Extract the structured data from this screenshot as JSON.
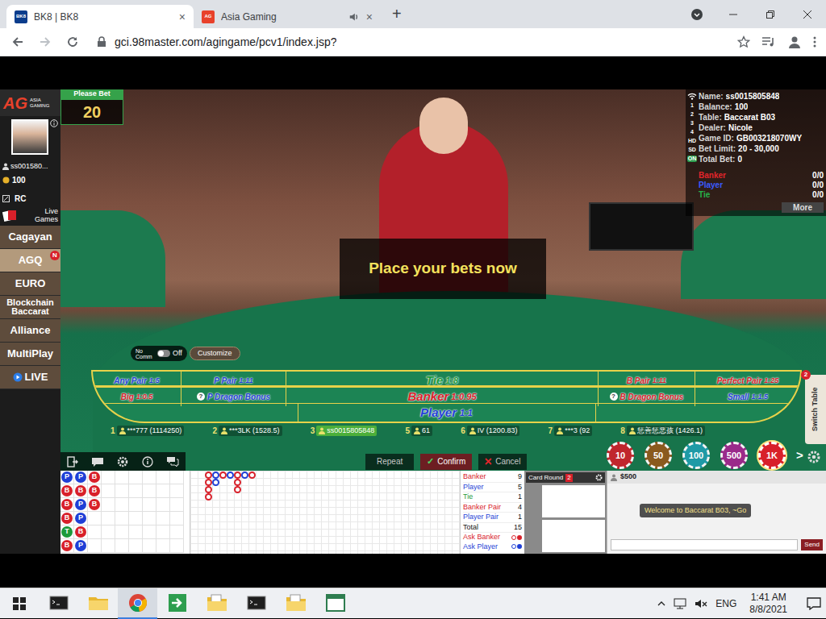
{
  "browser": {
    "tabs": [
      {
        "label": "BK8 | BK8",
        "favicon": "BK8",
        "close": "×",
        "audio": false,
        "selected": true
      },
      {
        "label": "Asia Gaming",
        "favicon": "AG",
        "close": "×",
        "audio": true,
        "selected": false
      }
    ],
    "new_tab": "+",
    "url": "gci.98master.com/agingame/pcv1/index.jsp?"
  },
  "sidebar": {
    "logo": "AG",
    "logo_sub": "ASIA GAMING",
    "user": "ss001580...",
    "balance": "100",
    "rc": "RC",
    "live_games": "Live Games",
    "items": [
      {
        "label": "Cagayan",
        "selected": false
      },
      {
        "label": "AGQ",
        "selected": true,
        "badge": "N"
      },
      {
        "label": "EURO",
        "selected": false
      },
      {
        "label": "Blockchain Baccarat",
        "selected": false
      },
      {
        "label": "Alliance",
        "selected": false
      },
      {
        "label": "MultiPlay",
        "selected": false
      },
      {
        "label": "LIVE",
        "selected": false
      }
    ]
  },
  "game": {
    "please_bet": "Please Bet",
    "countdown": "20",
    "message": "Place your bets now",
    "no_comm": {
      "label": "No Comm",
      "state": "Off",
      "on": false
    },
    "customize": "Customize",
    "info": {
      "side": [
        "1",
        "2",
        "3",
        "4",
        "HD",
        "SD",
        "ON"
      ],
      "rows": [
        {
          "label": "Name:",
          "value": "ss0015805848"
        },
        {
          "label": "Balance:",
          "value": "100"
        },
        {
          "label": "Table:",
          "value": "Baccarat B03"
        },
        {
          "label": "Dealer:",
          "value": "Nicole"
        },
        {
          "label": "Game ID:",
          "value": "GB003218070WY"
        },
        {
          "label": "Bet Limit:",
          "value": "20 - 30,000"
        },
        {
          "label": "Total Bet:",
          "value": "0"
        }
      ],
      "totals": [
        {
          "label": "Banker",
          "value": "0/0",
          "color": "#e0252b"
        },
        {
          "label": "Player",
          "value": "0/0",
          "color": "#3b5bff"
        },
        {
          "label": "Tie",
          "value": "0/0",
          "color": "#27b34a"
        }
      ],
      "more": "More"
    },
    "bets": [
      [
        {
          "label": "Any Pair",
          "odds": "1:5",
          "color": "#1f3fd6"
        },
        {
          "label": "P Pair",
          "odds": "1:11",
          "color": "#1f3fd6"
        },
        {
          "label": "Tie",
          "odds": "1:8",
          "color": "#1c9a3a"
        },
        {
          "label": "B Pair",
          "odds": "1:11",
          "color": "#d8202a"
        },
        {
          "label": "Perfect Pair",
          "odds": "1:25",
          "color": "#d8202a"
        }
      ],
      [
        {
          "label": "Big",
          "odds": "1:0.5",
          "color": "#d8202a"
        },
        {
          "label": "P Dragon Bonus",
          "help": "?",
          "color": "#1f3fd6"
        },
        {
          "label": "Banker",
          "odds": "1:0.95",
          "color": "#d8202a"
        },
        {
          "label": "B Dragon Bonus",
          "help": "?",
          "color": "#d8202a"
        },
        {
          "label": "Small",
          "odds": "1:1.5",
          "color": "#1f3fd6"
        }
      ],
      [
        {
          "label": "Player",
          "odds": "1:1",
          "color": "#1f3fd6"
        }
      ]
    ],
    "seats": [
      {
        "number": "1",
        "player": "***777 (1114250)",
        "selected": false
      },
      {
        "number": "2",
        "player": "***3LK (1528.5)",
        "selected": false
      },
      {
        "number": "3",
        "player": "ss0015805848",
        "selected": true
      },
      {
        "number": "5",
        "player": "61",
        "selected": false
      },
      {
        "number": "6",
        "player": "IV (1200.83)",
        "selected": false
      },
      {
        "number": "7",
        "player": "***3 (92",
        "selected": false
      },
      {
        "number": "8",
        "player": "惩善惩恶孩 (1426.1)",
        "selected": false
      }
    ],
    "actions": {
      "repeat": "Repeat",
      "check": "✓",
      "confirm": "Confirm",
      "cancel": "Cancel"
    },
    "chips": [
      {
        "value": "10",
        "color": "#c0262d",
        "selected": false
      },
      {
        "value": "50",
        "color": "#8a5a1e",
        "selected": false
      },
      {
        "value": "100",
        "color": "#1e9aa6",
        "selected": false
      },
      {
        "value": "500",
        "color": "#9a2a8a",
        "selected": false
      },
      {
        "value": "1K",
        "color": "#d8202a",
        "selected": true
      }
    ],
    "chips_more": ">",
    "switch_table": {
      "label": "Switch Table",
      "badge": "2"
    }
  },
  "roads": {
    "bead": [
      [
        "P",
        "B",
        "B",
        "B",
        "T",
        "B"
      ],
      [
        "P",
        "B",
        "P",
        "P",
        "B",
        "P"
      ],
      [
        "B",
        "B",
        "B"
      ]
    ],
    "big": [
      [
        "B",
        "B",
        "B",
        "B"
      ],
      [
        "P",
        "P"
      ],
      [
        "B"
      ],
      [
        "P"
      ],
      [
        "B",
        "B",
        "B"
      ],
      [
        "P"
      ],
      [
        "B"
      ]
    ],
    "stats": [
      {
        "label": "Banker",
        "value": "9",
        "color": "#d8202a"
      },
      {
        "label": "Player",
        "value": "5",
        "color": "#1f3fd6"
      },
      {
        "label": "Tie",
        "value": "1",
        "color": "#1c9a3a"
      },
      {
        "label": "Banker Pair",
        "value": "4",
        "color": "#d8202a"
      },
      {
        "label": "Player Pair",
        "value": "1",
        "color": "#1f3fd6"
      },
      {
        "label": "Total",
        "value": "15",
        "color": "#111111"
      }
    ],
    "ask": [
      {
        "label": "Ask Banker",
        "color": "#d8202a"
      },
      {
        "label": "Ask Player",
        "color": "#1f3fd6"
      }
    ]
  },
  "card_road": {
    "title": "Card Round",
    "count": "2"
  },
  "chat": {
    "amount": "$500",
    "welcome": "Welcome to Baccarat B03, ~Go",
    "send": "Send"
  },
  "taskbar": {
    "apps": [
      {
        "kind": "terminal",
        "selected": false
      },
      {
        "kind": "folder",
        "selected": false
      },
      {
        "kind": "chrome",
        "selected": true
      },
      {
        "kind": "arrow",
        "selected": false
      },
      {
        "kind": "files",
        "selected": false
      },
      {
        "kind": "terminal",
        "selected": false
      },
      {
        "kind": "files",
        "selected": false
      },
      {
        "kind": "app",
        "selected": false
      }
    ],
    "lang": "ENG",
    "time": "1:41 AM",
    "date": "8/8/2021"
  }
}
